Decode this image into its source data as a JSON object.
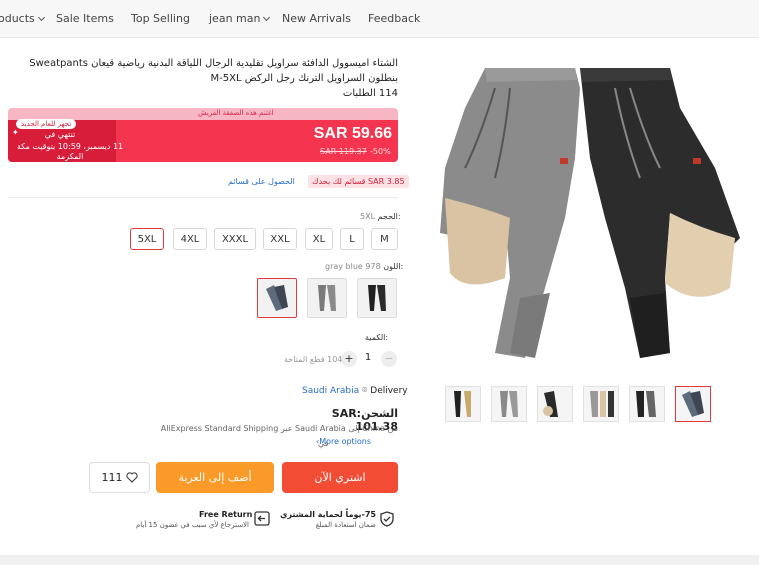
{
  "nav": {
    "items": [
      "oducts",
      "Sale Items",
      "Top Selling",
      "jean man",
      "New Arrivals",
      "Feedback"
    ]
  },
  "product": {
    "title": "الشتاء اميسوول الدافئة سراويل تقليدية الرجال اللياقة البدنية رياضية قيعان Sweatpants بنطلون السراويل الترنك رجل الركض M-5XL",
    "orders": "114 الطلبات"
  },
  "banner": {
    "top_text": "اغتنم هذه الصفقة الفريش",
    "promo_tag": "تجهز للعام الجديد",
    "ends_label": "تنتهي في",
    "ends_date": "11 ديسمبر، 10:59 بتوقيت مكة المكرمة",
    "price": "SAR 59.66",
    "old_price": "SAR 119.37",
    "discount": "-50%"
  },
  "coupon": {
    "badge": "SAR 3.85 قسائم لك بحدك",
    "link": "الحصول على قسائم"
  },
  "size": {
    "label": "الحجم:",
    "selected": "5XL",
    "options": [
      "M",
      "L",
      "XL",
      "XXL",
      "XXXL",
      "4XL",
      "5XL"
    ]
  },
  "color": {
    "label": "اللون:",
    "selected": "gray blue 978",
    "swatches": [
      "black",
      "gray",
      "gray blue"
    ]
  },
  "quantity": {
    "label": "الكمية:",
    "value": "1",
    "available": "104 قطع المتاحة"
  },
  "shipping": {
    "delivery_to": "Saudi Arabia",
    "delivery_label": "Delivery",
    "cost": "الشحن:SAR 101.38",
    "from_line": "من China إلى Saudi Arabia عبر AliExpress Standard Shipping",
    "in_word": "في",
    "more_options": "More options"
  },
  "actions": {
    "buy_now": "اشتري الآن",
    "add_to_cart": "أضف إلى العربة",
    "wishlist_count": "111"
  },
  "guarantees": {
    "protection_title": "75-يوماً لحماية المشتري",
    "protection_sub": "ضمان استعادة المبلغ",
    "return_title": "Free Return",
    "return_sub": "الاسترجاع لأي سبب في غضون 15 أيام"
  },
  "colors": {
    "accent_red": "#f5354f",
    "buy_orange_red": "#f24c35",
    "cart_orange": "#fa9a28",
    "link_blue": "#2a6ec9"
  }
}
